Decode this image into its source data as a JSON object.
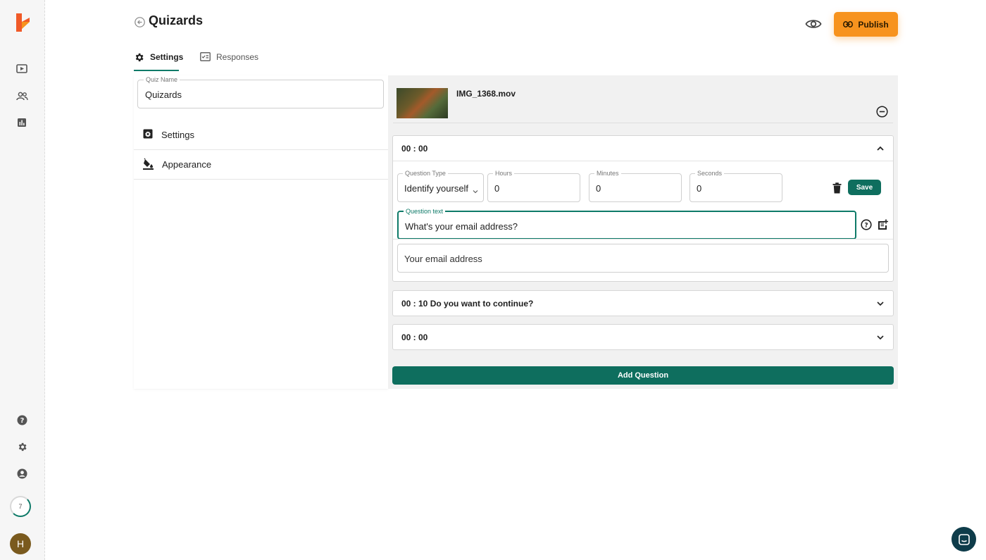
{
  "app": {
    "logo": "brand-logo-icon",
    "avatar_letter": "H",
    "progress_count": "7"
  },
  "rail": {
    "icons": [
      "play-screen-icon",
      "users-icon",
      "chart-icon",
      "help-icon",
      "settings-icon",
      "account-icon"
    ]
  },
  "header": {
    "title": "Quizards",
    "publish_label": "Publish"
  },
  "tabs": [
    {
      "label": "Settings",
      "icon": "gear-icon",
      "active": true
    },
    {
      "label": "Responses",
      "icon": "responses-icon",
      "active": false
    }
  ],
  "settings_panel": {
    "quiz_name_label": "Quiz Name",
    "quiz_name_value": "Quizards",
    "menu": [
      {
        "label": "Settings",
        "icon": "settings-box-icon"
      },
      {
        "label": "Appearance",
        "icon": "paint-bucket-icon"
      }
    ]
  },
  "editor": {
    "video": {
      "filename": "IMG_1368.mov"
    },
    "questions": [
      {
        "header": "00 : 00",
        "expanded": true,
        "question_type_label": "Question Type",
        "question_type_value": "Identify yourself",
        "hours_label": "Hours",
        "hours_value": "0",
        "minutes_label": "Minutes",
        "minutes_value": "0",
        "seconds_label": "Seconds",
        "seconds_value": "0",
        "save_label": "Save",
        "question_text_label": "Question text",
        "question_text_value": "What's your email address?",
        "answer_placeholder": "Your email address"
      },
      {
        "header": "00 : 10 Do you want to continue?",
        "expanded": false
      },
      {
        "header": "00 : 00",
        "expanded": false
      }
    ],
    "add_question_label": "Add Question"
  },
  "colors": {
    "accent": "#0e6e5e",
    "publish": "#f7931e",
    "logo": "#f05a28"
  }
}
